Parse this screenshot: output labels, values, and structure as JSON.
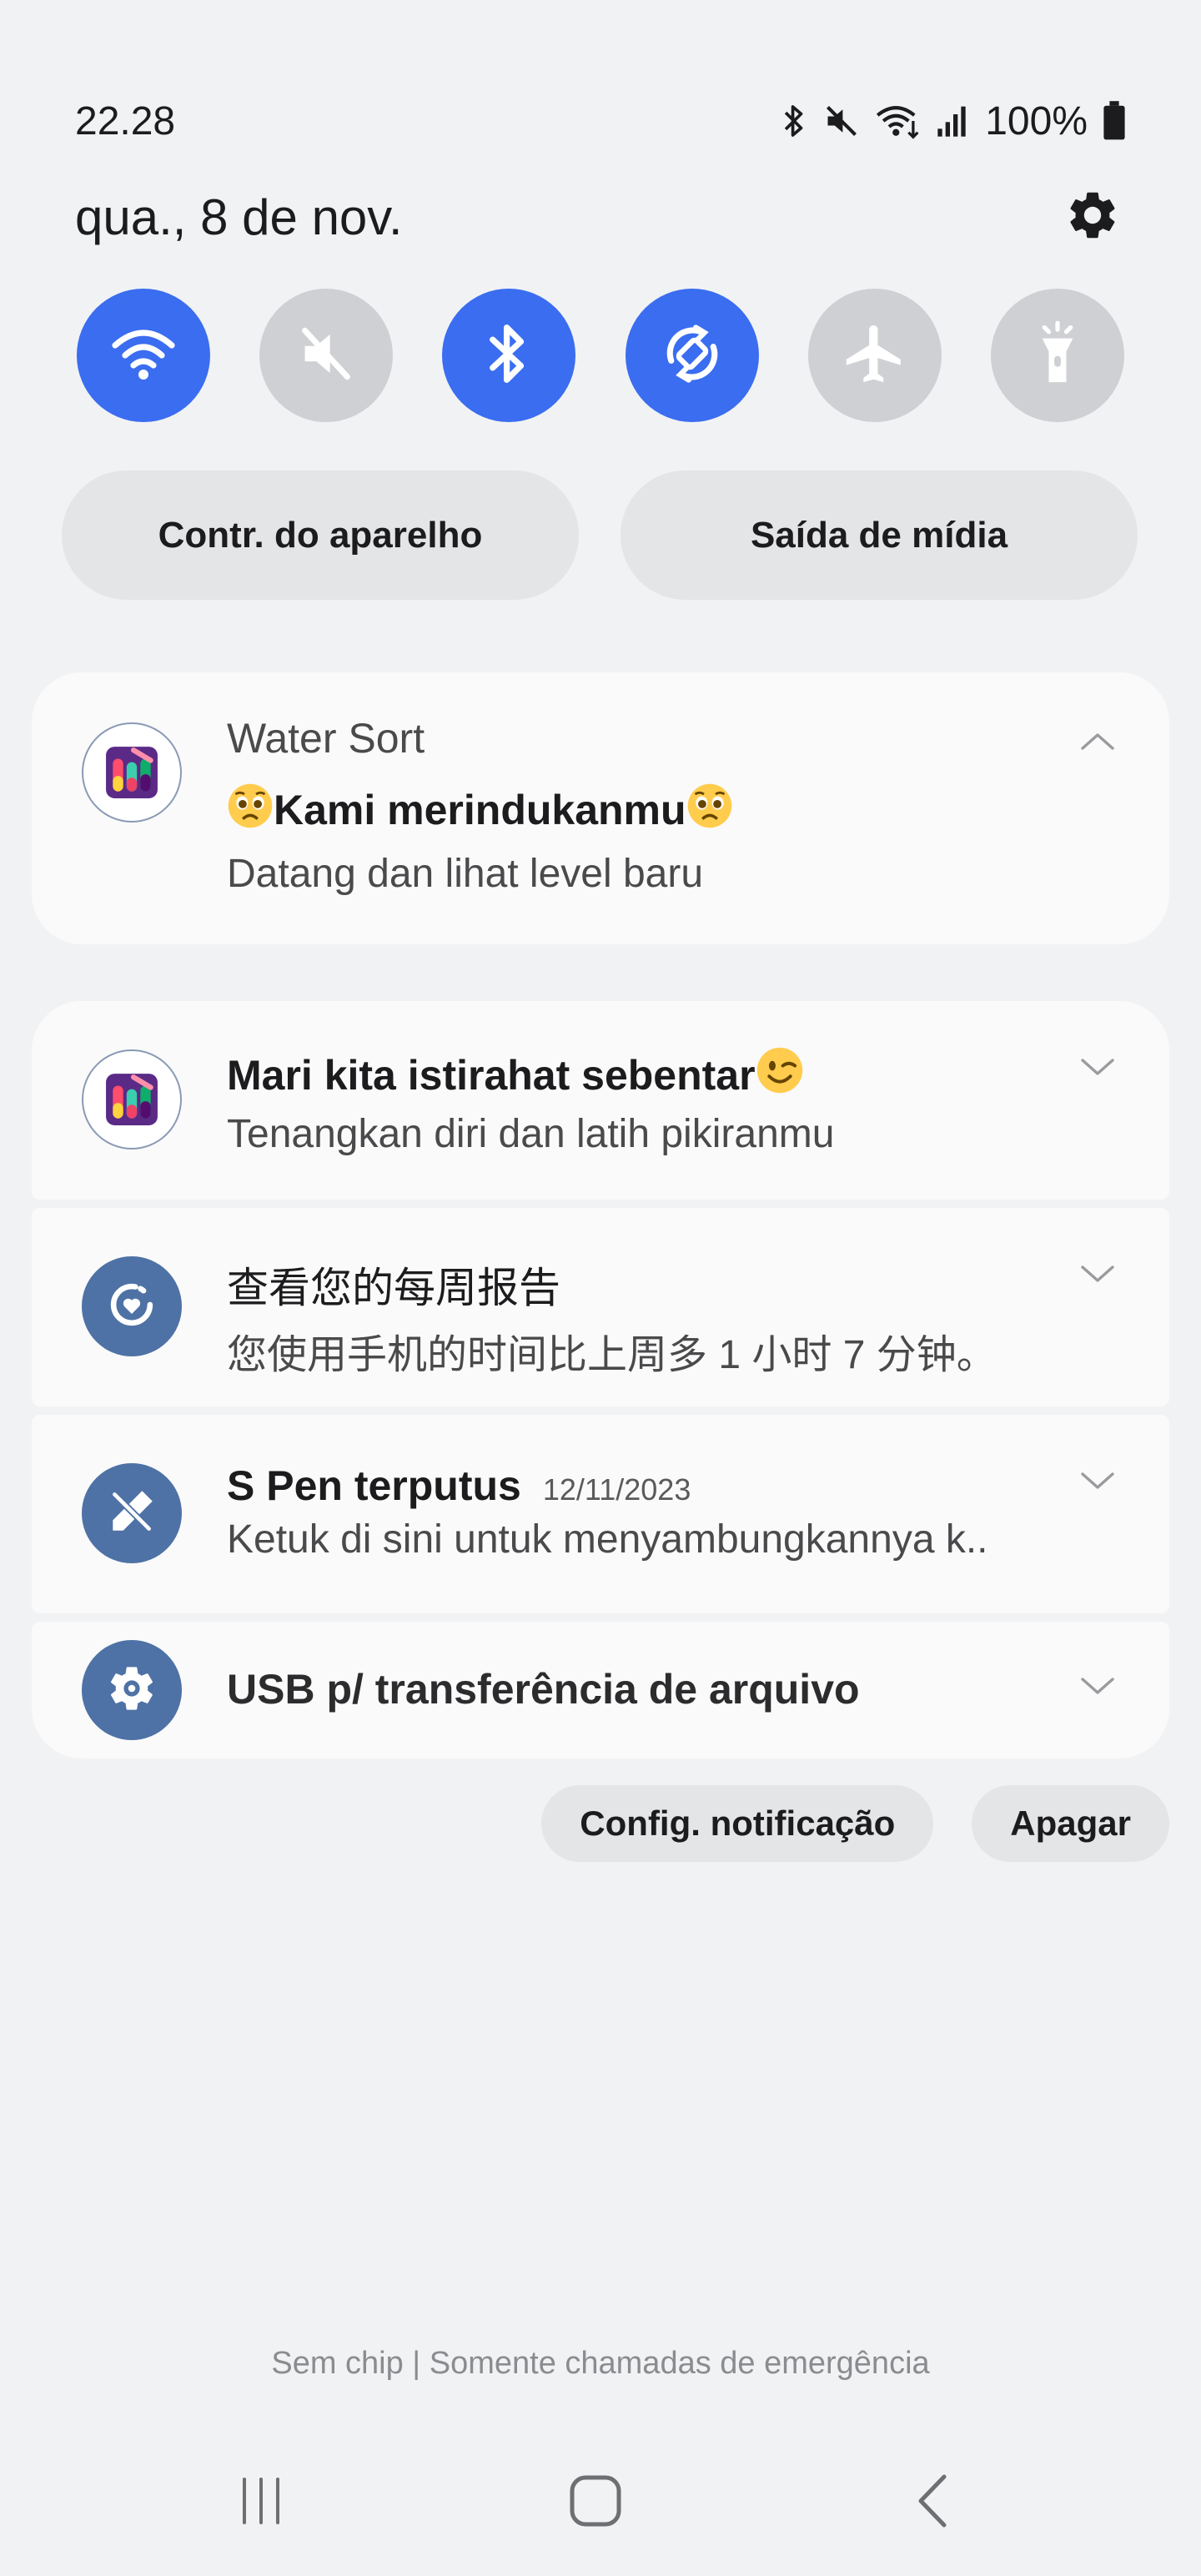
{
  "status_bar": {
    "time": "22.28",
    "battery": "100%",
    "icons": [
      "bluetooth-icon",
      "mute-icon",
      "wifi-sync-icon",
      "signal-icon",
      "battery-icon"
    ]
  },
  "header": {
    "date": "qua., 8 de nov.",
    "settings_icon": "gear-icon"
  },
  "quick_toggles": [
    {
      "icon": "wifi-icon",
      "state": "on"
    },
    {
      "icon": "mute-icon",
      "state": "off"
    },
    {
      "icon": "bluetooth-icon",
      "state": "on"
    },
    {
      "icon": "auto-rotate-icon",
      "state": "on"
    },
    {
      "icon": "airplane-icon",
      "state": "off"
    },
    {
      "icon": "flashlight-icon",
      "state": "off"
    }
  ],
  "pills": {
    "device_control": "Contr. do aparelho",
    "media_output": "Saída de mídia"
  },
  "notifications": {
    "water_sort": {
      "app": "Water Sort",
      "title": "Kami merindukanmu",
      "body": "Datang dan lihat level baru"
    },
    "break": {
      "title": "Mari kita istirahat sebentar",
      "body": "Tenangkan diri dan latih pikiranmu"
    },
    "weekly_report": {
      "title": "查看您的每周报告",
      "body": "您使用手机的时间比上周多 1 小时 7 分钟。"
    },
    "spen": {
      "title": "S Pen terputus",
      "date": "12/11/2023",
      "body": "Ketuk di sini untuk menyambungkannya k.."
    },
    "usb": {
      "title": "USB p/ transferência de arquivo"
    }
  },
  "actions": {
    "notification_settings": "Config. notificação",
    "clear": "Apagar"
  },
  "carrier_text": "Sem chip | Somente chamadas de emergência",
  "colors": {
    "accent": "#3a6df0",
    "toggle_off": "#cfd0d3",
    "background": "#f1f2f4",
    "card": "#fafafa",
    "app_icon_blue": "#4e72a5"
  }
}
